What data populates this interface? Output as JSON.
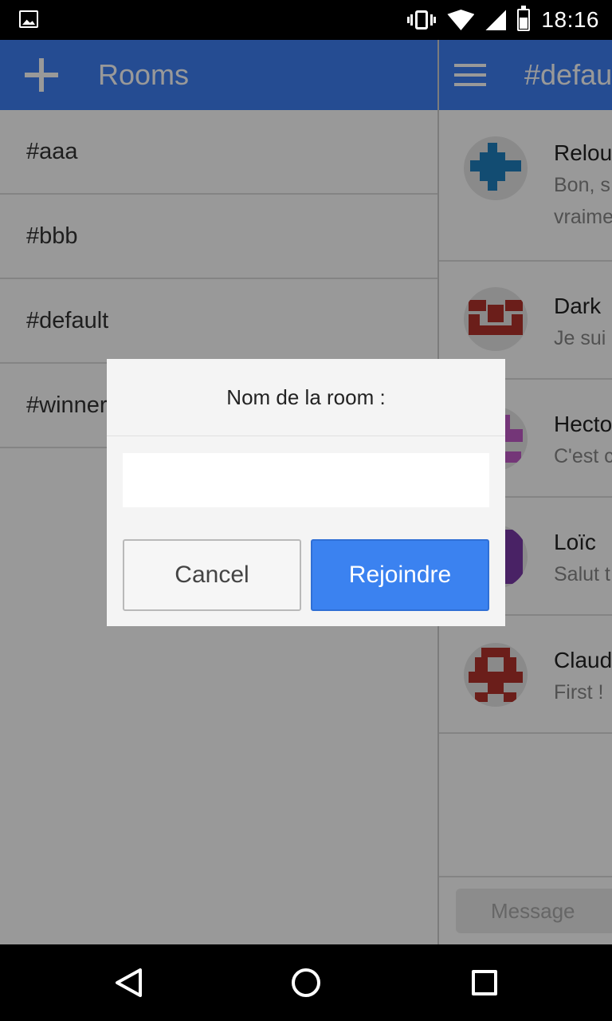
{
  "status_bar": {
    "time": "18:16"
  },
  "left_panel": {
    "title": "Rooms",
    "rooms": [
      {
        "label": "#aaa"
      },
      {
        "label": "#bbb"
      },
      {
        "label": "#default"
      },
      {
        "label": "#winners are here"
      }
    ]
  },
  "right_panel": {
    "channel": "#default",
    "messages": [
      {
        "author": "Relou",
        "lines": [
          "Bon, s",
          "vraime"
        ],
        "avatar_color": "#1e7fbf"
      },
      {
        "author": "Dark",
        "lines": [
          "Je sui"
        ],
        "avatar_color": "#b3322c"
      },
      {
        "author": "Hecto",
        "lines": [
          "C'est c"
        ],
        "avatar_color": "#c15bc9"
      },
      {
        "author": "Loïc",
        "lines": [
          "Salut t"
        ],
        "avatar_color": "#7a3aa8"
      },
      {
        "author": "Claud",
        "lines": [
          "First !"
        ],
        "avatar_color": "#b3322c"
      }
    ],
    "message_placeholder": "Message"
  },
  "dialog": {
    "title": "Nom de la room :",
    "input_value": "",
    "cancel_label": "Cancel",
    "join_label": "Rejoindre"
  },
  "colors": {
    "accent": "#3f7ff3",
    "join_button": "#3b82f0"
  }
}
